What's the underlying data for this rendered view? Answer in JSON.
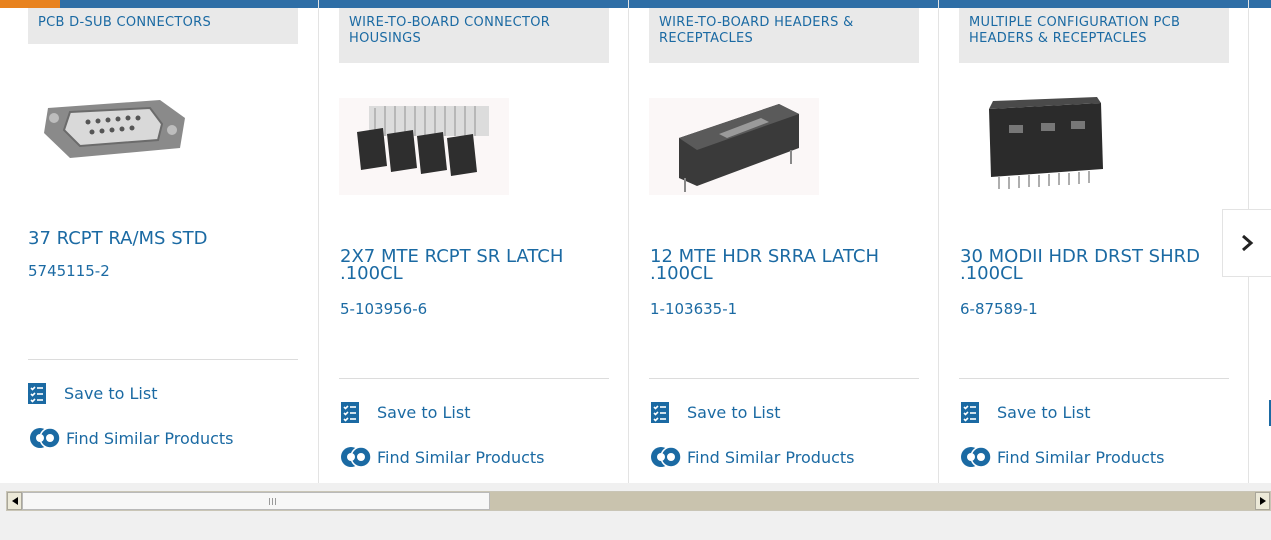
{
  "products": [
    {
      "category": "PCB D-SUB CONNECTORS",
      "name": "37 RCPT RA/MS STD",
      "part_number": "5745115-2",
      "image_icon": "d-sub-connector-image",
      "save_label": "Save to List",
      "similar_label": "Find Similar Products"
    },
    {
      "category": "WIRE-TO-BOARD CONNECTOR HOUSINGS",
      "name": "2X7 MTE RCPT SR LATCH .100CL",
      "part_number": "5-103956-6",
      "image_icon": "connector-housing-strip-image",
      "save_label": "Save to List",
      "similar_label": "Find Similar Products"
    },
    {
      "category": "WIRE-TO-BOARD HEADERS & RECEPTACLES",
      "name": "12 MTE HDR SRRA LATCH .100CL",
      "part_number": "1-103635-1",
      "image_icon": "right-angle-header-image",
      "save_label": "Save to List",
      "similar_label": "Find Similar Products"
    },
    {
      "category": "MULTIPLE CONFIGURATION PCB HEADERS & RECEPTACLES",
      "name": "30 MODII HDR DRST SHRD .100CL",
      "part_number": "6-87589-1",
      "image_icon": "shrouded-header-image",
      "save_label": "Save to List",
      "similar_label": "Find Similar Products"
    }
  ],
  "carousel": {
    "next_icon": "chevron-right-icon"
  },
  "scrollbar": {
    "left_icon": "arrow-left-icon",
    "right_icon": "arrow-right-icon"
  },
  "colors": {
    "link": "#1b6aa3",
    "topbar": "#2e6ea6",
    "accent": "#e8821e",
    "category_bg": "#e9e9e9"
  }
}
